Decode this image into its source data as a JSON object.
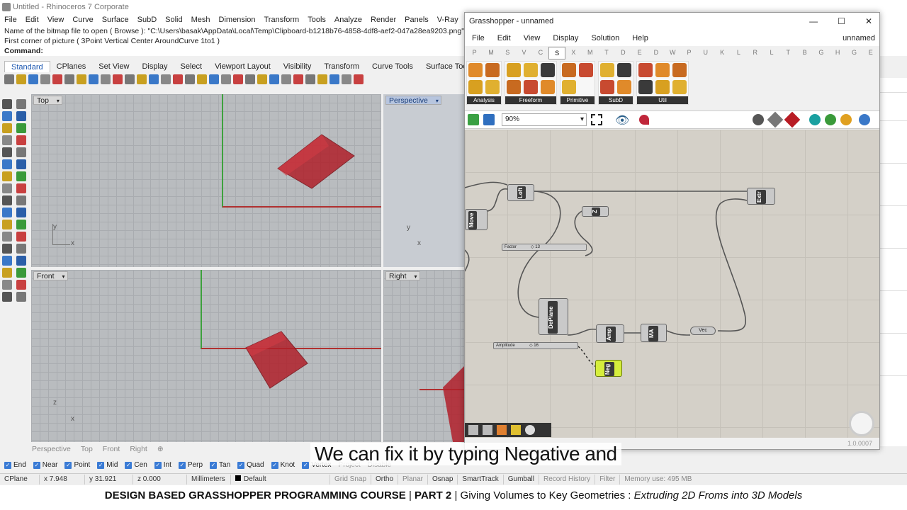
{
  "rhino": {
    "title": "Untitled - Rhinoceros 7 Corporate",
    "menu": [
      "File",
      "Edit",
      "View",
      "Curve",
      "Surface",
      "SubD",
      "Solid",
      "Mesh",
      "Dimension",
      "Transform",
      "Tools",
      "Analyze",
      "Render",
      "Panels",
      "V-Ray",
      "Help"
    ],
    "cmd_line1": "Name of the bitmap file to open ( Browse ): \"C:\\Users\\basak\\AppData\\Local\\Temp\\Clipboard-b1218b76-4858-4df8-aef2-047a28ea9203.png\"",
    "cmd_line2": "First corner of picture ( 3Point  Vertical  Center  AroundCurve  1to1 )",
    "cmd_prompt": "Command:",
    "tabs": [
      "Standard",
      "CPlanes",
      "Set View",
      "Display",
      "Select",
      "Viewport Layout",
      "Visibility",
      "Transform",
      "Curve Tools",
      "Surface Tools"
    ],
    "viewports": {
      "top": "Top",
      "perspective": "Perspective",
      "front": "Front",
      "right": "Right"
    },
    "axis": {
      "x": "x",
      "y": "y",
      "z": "z"
    },
    "viewport_tabs": [
      "Perspective",
      "Top",
      "Front",
      "Right",
      "⊕"
    ],
    "osnaps": [
      "End",
      "Near",
      "Point",
      "Mid",
      "Cen",
      "Int",
      "Perp",
      "Tan",
      "Quad",
      "Knot",
      "Vertex",
      "Project",
      "Disable"
    ],
    "status": {
      "cplane": "CPlane",
      "x": "x 7.948",
      "y": "y 31.921",
      "z": "z 0.000",
      "units": "Millimeters",
      "layer": "Default",
      "grid_snap": "Grid Snap",
      "ortho": "Ortho",
      "planar": "Planar",
      "osnap": "Osnap",
      "smarttrack": "SmartTrack",
      "gumball": "Gumball",
      "record": "Record History",
      "filter": "Filter",
      "memory": "Memory use: 495 MB"
    }
  },
  "grasshopper": {
    "title": "Grasshopper - unnamed",
    "menu": [
      "File",
      "Edit",
      "View",
      "Display",
      "Solution",
      "Help"
    ],
    "doc_name": "unnamed",
    "tab_letters": [
      "P",
      "M",
      "S",
      "V",
      "C",
      "S",
      "X",
      "M",
      "T",
      "D",
      "E",
      "D",
      "W",
      "P",
      "U",
      "K",
      "L",
      "R",
      "L",
      "T",
      "B",
      "G",
      "H",
      "G",
      "E"
    ],
    "active_letter_index": 5,
    "ribbon_groups": [
      "Analysis",
      "Freeform",
      "Primitive",
      "SubD",
      "Util"
    ],
    "zoom": "90%",
    "components": {
      "loft": "Loft",
      "move": "Move",
      "z": "Z",
      "extr": "Extr",
      "deplane": "DePlane",
      "amp": "Amp",
      "ma": "MA",
      "vec": "Vec",
      "neg": "Neg"
    },
    "sliders": [
      {
        "label": "Factor",
        "value": "◇ 13"
      },
      {
        "label": "Amplitude",
        "value": "◇ 16"
      }
    ],
    "version": "1.0.0007"
  },
  "subtitle": "We can fix it by typing Negative and",
  "footer": {
    "course": "DESIGN BASED GRASSHOPPER PROGRAMMING COURSE",
    "sep": "|",
    "part": "PART 2",
    "desc": "Giving Volumes to Key Geometries : ",
    "italic": "Extruding 2D Froms into 3D Models"
  }
}
